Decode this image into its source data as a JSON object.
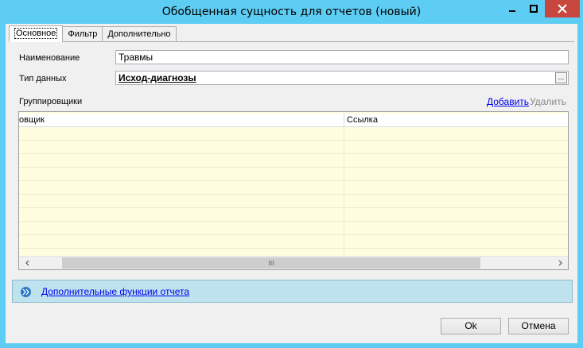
{
  "window": {
    "title": "Обобщенная сущность для отчетов (новый)"
  },
  "tabs": [
    {
      "label": "Основное",
      "active": true
    },
    {
      "label": "Фильтр",
      "active": false
    },
    {
      "label": "Дополнительно",
      "active": false
    }
  ],
  "form": {
    "name_label": "Наименование",
    "name_value": "Травмы",
    "datatype_label": "Тип данных",
    "datatype_value": "Исход-диагнозы",
    "datatype_button": "..."
  },
  "groupers": {
    "label": "Группировщики",
    "add_link": "Добавить",
    "delete_link": "Удалить",
    "columns": [
      "овщик",
      "Ссылка"
    ],
    "rows": [],
    "scroll_thumb": "III"
  },
  "extra": {
    "link_label": "Дополнительные функции отчета"
  },
  "buttons": {
    "ok": "Ok",
    "cancel": "Отмена"
  },
  "colors": {
    "titlebar": "#5ecdf3",
    "close_button": "#c7473e",
    "grid_background": "#fffde0",
    "func_bar": "#bfe3ee"
  }
}
